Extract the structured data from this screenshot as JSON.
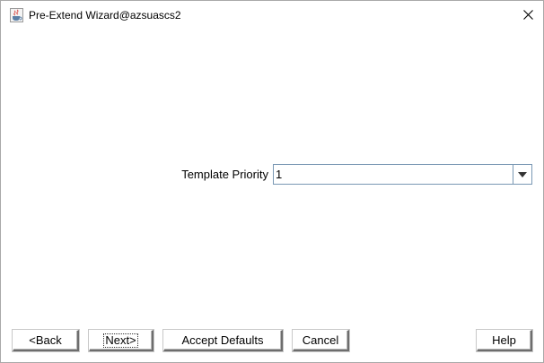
{
  "window": {
    "title": "Pre-Extend Wizard@azsuascs2",
    "app_icon": "java-cup-icon",
    "close_icon": "close-icon"
  },
  "form": {
    "template_priority_label": "Template Priority",
    "template_priority_value": "1",
    "dropdown_icon": "chevron-down-icon"
  },
  "buttons": {
    "back": "<Back",
    "next": "Next>",
    "accept_defaults": "Accept Defaults",
    "cancel": "Cancel",
    "help": "Help"
  }
}
